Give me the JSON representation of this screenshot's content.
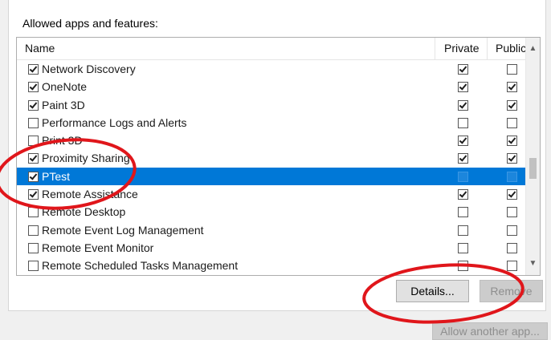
{
  "group": {
    "title": "Allowed apps and features:"
  },
  "table": {
    "columns": {
      "name": "Name",
      "private": "Private",
      "public": "Public"
    },
    "rows": [
      {
        "name": "Network Discovery",
        "enabled": true,
        "private": true,
        "public": false,
        "selected": false
      },
      {
        "name": "OneNote",
        "enabled": true,
        "private": true,
        "public": true,
        "selected": false
      },
      {
        "name": "Paint 3D",
        "enabled": true,
        "private": true,
        "public": true,
        "selected": false
      },
      {
        "name": "Performance Logs and Alerts",
        "enabled": false,
        "private": false,
        "public": false,
        "selected": false
      },
      {
        "name": "Print 3D",
        "enabled": false,
        "private": true,
        "public": true,
        "selected": false
      },
      {
        "name": "Proximity Sharing",
        "enabled": true,
        "private": true,
        "public": true,
        "selected": false
      },
      {
        "name": "PTest",
        "enabled": true,
        "private": false,
        "public": false,
        "selected": true
      },
      {
        "name": "Remote Assistance",
        "enabled": true,
        "private": true,
        "public": true,
        "selected": false
      },
      {
        "name": "Remote Desktop",
        "enabled": false,
        "private": false,
        "public": false,
        "selected": false
      },
      {
        "name": "Remote Event Log Management",
        "enabled": false,
        "private": false,
        "public": false,
        "selected": false
      },
      {
        "name": "Remote Event Monitor",
        "enabled": false,
        "private": false,
        "public": false,
        "selected": false
      },
      {
        "name": "Remote Scheduled Tasks Management",
        "enabled": false,
        "private": false,
        "public": false,
        "selected": false
      }
    ]
  },
  "buttons": {
    "details": "Details...",
    "remove": "Remove",
    "allow_another": "Allow another app..."
  },
  "colors": {
    "selection": "#0078d7",
    "annotation": "#e0161b"
  },
  "icons": {
    "scroll_up": "chevron-up-icon",
    "scroll_down": "chevron-down-icon"
  }
}
